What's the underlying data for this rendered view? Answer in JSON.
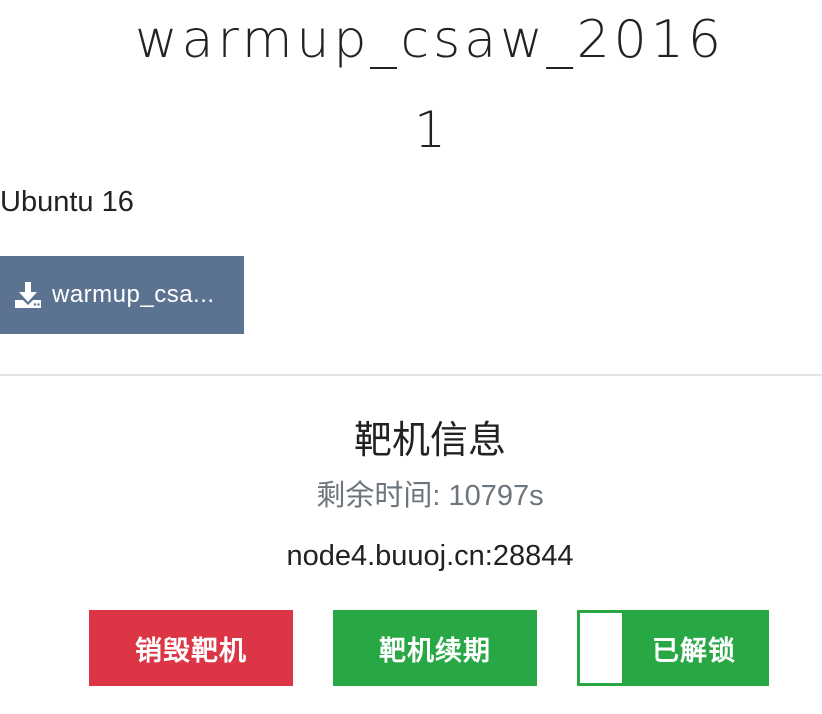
{
  "challenge": {
    "title": "warmup_csaw_2016",
    "points": "1",
    "description": "Ubuntu 16",
    "download_label": "warmup_csa...",
    "download_icon": "download-icon"
  },
  "target": {
    "heading": "靶机信息",
    "time_remaining": "剩余时间: 10797s",
    "address": "node4.buuoj.cn:28844"
  },
  "actions": {
    "destroy_label": "销毁靶机",
    "renew_label": "靶机续期",
    "unlocked_label": "已解锁"
  },
  "colors": {
    "download_button": "#5c7291",
    "destroy": "#dc3545",
    "renew": "#28a745",
    "unlocked": "#28a745",
    "muted_text": "#6c757d"
  }
}
